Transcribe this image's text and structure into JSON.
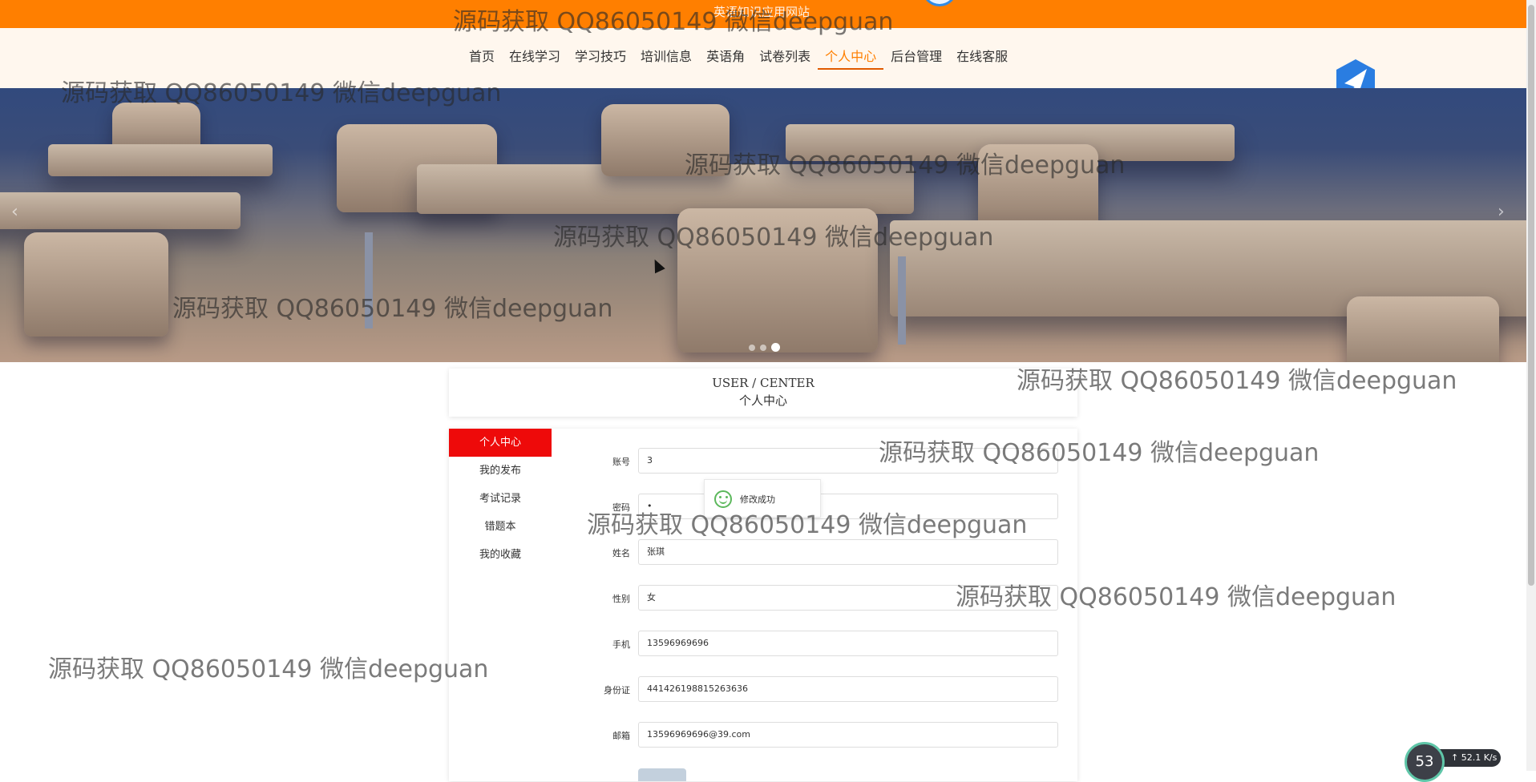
{
  "topbar": {
    "site_title": "英语知识应用网站"
  },
  "nav": {
    "items": [
      "首页",
      "在线学习",
      "学习技巧",
      "培训信息",
      "英语角",
      "试卷列表",
      "个人中心",
      "后台管理",
      "在线客服"
    ],
    "active": "个人中心"
  },
  "banner": {
    "prev_icon": "‹",
    "next_icon": "›",
    "slide_count": 3,
    "active_slide": 3
  },
  "header": {
    "en": "USER / CENTER",
    "zh": "个人中心"
  },
  "side_menu": {
    "items": [
      "个人中心",
      "我的发布",
      "考试记录",
      "错题本",
      "我的收藏"
    ],
    "active": "个人中心"
  },
  "form": {
    "fields": [
      {
        "label": "账号",
        "value": "3"
      },
      {
        "label": "密码",
        "value": "•"
      },
      {
        "label": "姓名",
        "value": "张琪"
      },
      {
        "label": "性别",
        "value": "女"
      },
      {
        "label": "手机",
        "value": "13596969696"
      },
      {
        "label": "身份证",
        "value": "441426198815263636"
      },
      {
        "label": "邮箱",
        "value": "13596969696@39.com"
      }
    ]
  },
  "toast": {
    "message": "修改成功",
    "icon": "smile-icon"
  },
  "watermark": {
    "text": "源码获取 QQ86050149 微信deepguan"
  },
  "net_widget": {
    "percent": "53",
    "speed": "52.1",
    "unit": "K/s"
  },
  "colors": {
    "topbar": "#ff7f00",
    "active_nav": "#ff7f00",
    "side_active": "#ee0a0a"
  }
}
